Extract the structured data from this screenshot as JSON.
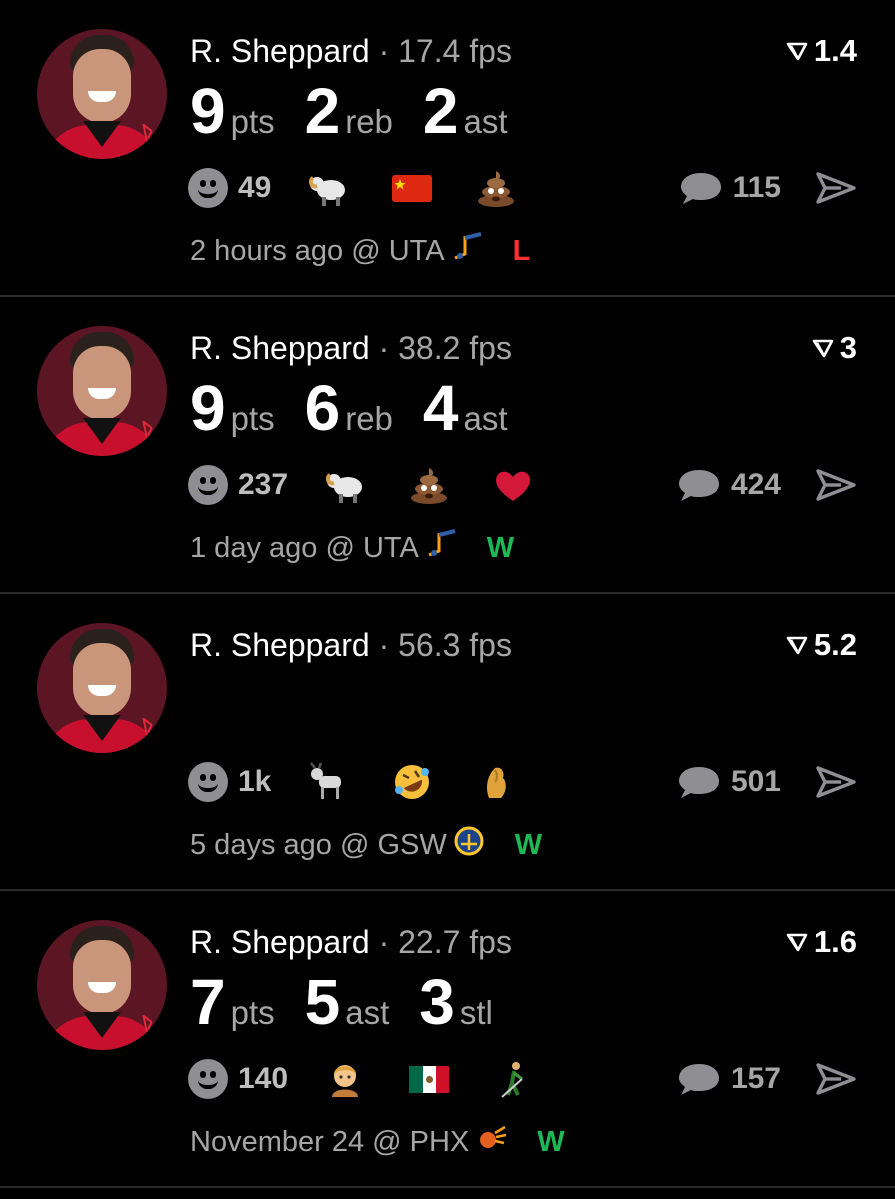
{
  "colors": {
    "background": "#000000",
    "secondary_text": "#a6a6a6",
    "win": "#1db954",
    "loss": "#ff3030"
  },
  "posts": [
    {
      "player": "R. Sheppard",
      "separator": "·",
      "fps": "17.4 fps",
      "score": "1.4",
      "stats": [
        {
          "num": "9",
          "label": "pts"
        },
        {
          "num": "2",
          "label": "reb"
        },
        {
          "num": "2",
          "label": "ast"
        }
      ],
      "reaction_count": "49",
      "emojis": [
        "ram-emoji",
        "china-flag-emoji",
        "poop-emoji"
      ],
      "comment_count": "115",
      "time": "2 hours ago @ UTA",
      "team_logo": "jazz-logo-icon",
      "result": "L"
    },
    {
      "player": "R. Sheppard",
      "separator": "·",
      "fps": "38.2 fps",
      "score": "3",
      "stats": [
        {
          "num": "9",
          "label": "pts"
        },
        {
          "num": "6",
          "label": "reb"
        },
        {
          "num": "4",
          "label": "ast"
        }
      ],
      "reaction_count": "237",
      "emojis": [
        "ram-emoji",
        "poop-emoji",
        "heart-emoji"
      ],
      "comment_count": "424",
      "time": "1 day ago @ UTA",
      "team_logo": "jazz-logo-icon",
      "result": "W"
    },
    {
      "player": "R. Sheppard",
      "separator": "·",
      "fps": "56.3 fps",
      "score": "5.2",
      "stats": [],
      "reaction_count": "1k",
      "emojis": [
        "goat-emoji",
        "rolling-laughing-emoji",
        "pinched-fingers-emoji"
      ],
      "comment_count": "501",
      "time": "5 days ago @ GSW",
      "team_logo": "warriors-logo-icon",
      "result": "W"
    },
    {
      "player": "R. Sheppard",
      "separator": "·",
      "fps": "22.7 fps",
      "score": "1.6",
      "stats": [
        {
          "num": "7",
          "label": "pts"
        },
        {
          "num": "5",
          "label": "ast"
        },
        {
          "num": "3",
          "label": "stl"
        }
      ],
      "reaction_count": "140",
      "emojis": [
        "person-emoji",
        "mexico-flag-emoji",
        "person-with-cane-emoji"
      ],
      "comment_count": "157",
      "time": "November 24 @ PHX",
      "team_logo": "suns-logo-icon",
      "result": "W"
    }
  ]
}
